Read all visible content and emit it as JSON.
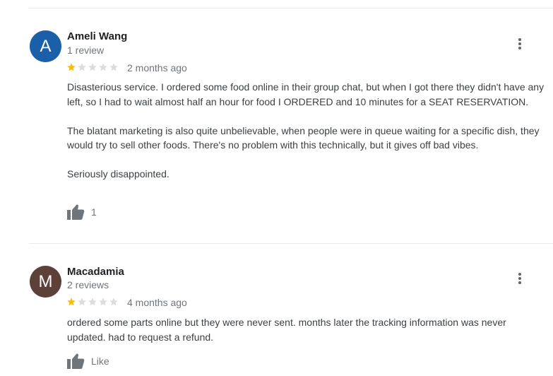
{
  "colors": {
    "star_filled": "#fbbc04",
    "star_empty": "#dadce0",
    "avatar_a": "#1a5fa8",
    "avatar_m": "#5d4037",
    "icon_gray": "#70757a"
  },
  "icons": {
    "menu": "more-vert-icon",
    "like": "thumb-up-icon",
    "star": "star-icon"
  },
  "reviews": [
    {
      "avatar_letter": "A",
      "name": "Ameli Wang",
      "review_count": "1 review",
      "rating": 1,
      "rating_max": 5,
      "date": "2 months ago",
      "paragraphs": [
        "Disasterious service. I ordered some food online in their group chat, but when I got there they didn't have any left, so I had to wait almost half an hour for food I ORDERED and 10 minutes for a SEAT RESERVATION.",
        "The blatant marketing is also quite unbelievable, when people were in queue waiting for a specific dish, they would try to sell other foods. There's no problem with this technically, but it gives off bad vibes.",
        "Seriously disappointed."
      ],
      "like_label": "1"
    },
    {
      "avatar_letter": "M",
      "name": "Macadamia",
      "review_count": "2 reviews",
      "rating": 1,
      "rating_max": 5,
      "date": "4 months ago",
      "paragraphs": [
        "ordered some parts online but they were never sent. months later the tracking information was never updated. had to request a refund."
      ],
      "like_label": "Like"
    }
  ]
}
